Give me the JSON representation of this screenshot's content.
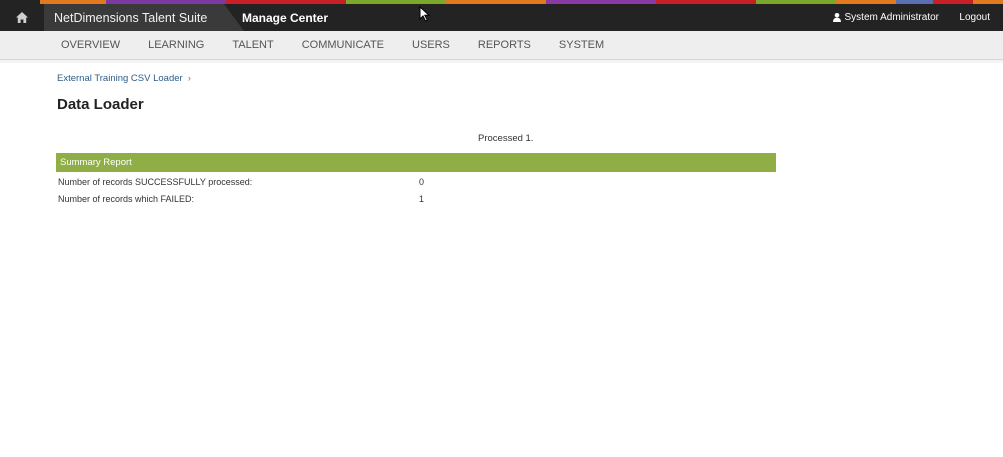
{
  "topbar": {
    "brand": "NetDimensions Talent Suite",
    "section": "Manage Center",
    "user": "System Administrator",
    "logout": "Logout",
    "home_icon": "home-icon",
    "user_icon": "user-icon",
    "stripe_colors": [
      "#232323",
      "#e07a1f",
      "#7b3aa3",
      "#c91f26",
      "#7aa82a",
      "#e07a1f",
      "#8b3aa3",
      "#c91f26",
      "#7aa82a",
      "#e07a1f",
      "#5a6fb0",
      "#c91f26",
      "#e07a1f"
    ]
  },
  "nav": {
    "items": [
      "OVERVIEW",
      "LEARNING",
      "TALENT",
      "COMMUNICATE",
      "USERS",
      "REPORTS",
      "SYSTEM"
    ]
  },
  "breadcrumb": {
    "link": "External Training CSV Loader",
    "separator": "›"
  },
  "page": {
    "title": "Data Loader",
    "status": "Processed 1."
  },
  "summary": {
    "header": "Summary Report",
    "accent_color": "#8fae46",
    "rows": [
      {
        "label": "Number of records SUCCESSFULLY processed:",
        "value": "0"
      },
      {
        "label": "Number of records which FAILED:",
        "value": "1"
      }
    ]
  }
}
